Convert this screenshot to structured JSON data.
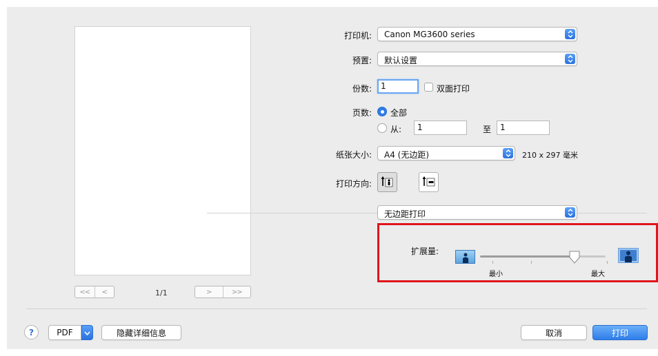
{
  "preview": {
    "page_indicator": "1/1",
    "first_label": "<<",
    "prev_label": "<",
    "next_label": ">",
    "last_label": ">>"
  },
  "printer": {
    "label": "打印机:",
    "value": "Canon MG3600 series"
  },
  "presets": {
    "label": "预置:",
    "value": "默认设置"
  },
  "copies": {
    "label": "份数:",
    "value": "1",
    "duplex_label": "双面打印",
    "duplex_checked": false
  },
  "pages": {
    "label": "页数:",
    "all_label": "全部",
    "from_label": "从:",
    "from_value": "1",
    "to_label": "至",
    "to_value": "1",
    "selected": "all"
  },
  "paper_size": {
    "label": "纸张大小:",
    "value": "A4 (无边距)",
    "dimensions": "210 x 297 毫米"
  },
  "orientation": {
    "label": "打印方向:",
    "selected": "portrait"
  },
  "section": {
    "value": "无边距打印"
  },
  "expansion": {
    "label": "扩展量:",
    "min_label": "最小",
    "max_label": "最大",
    "level_fraction": 0.75
  },
  "footer": {
    "help_label": "?",
    "pdf_label": "PDF",
    "hide_details_label": "隐藏详细信息",
    "cancel_label": "取消",
    "print_label": "打印"
  },
  "colors": {
    "accent": "#2f7de8",
    "highlight_border": "#e0141c",
    "dialog_bg": "#ececec"
  }
}
